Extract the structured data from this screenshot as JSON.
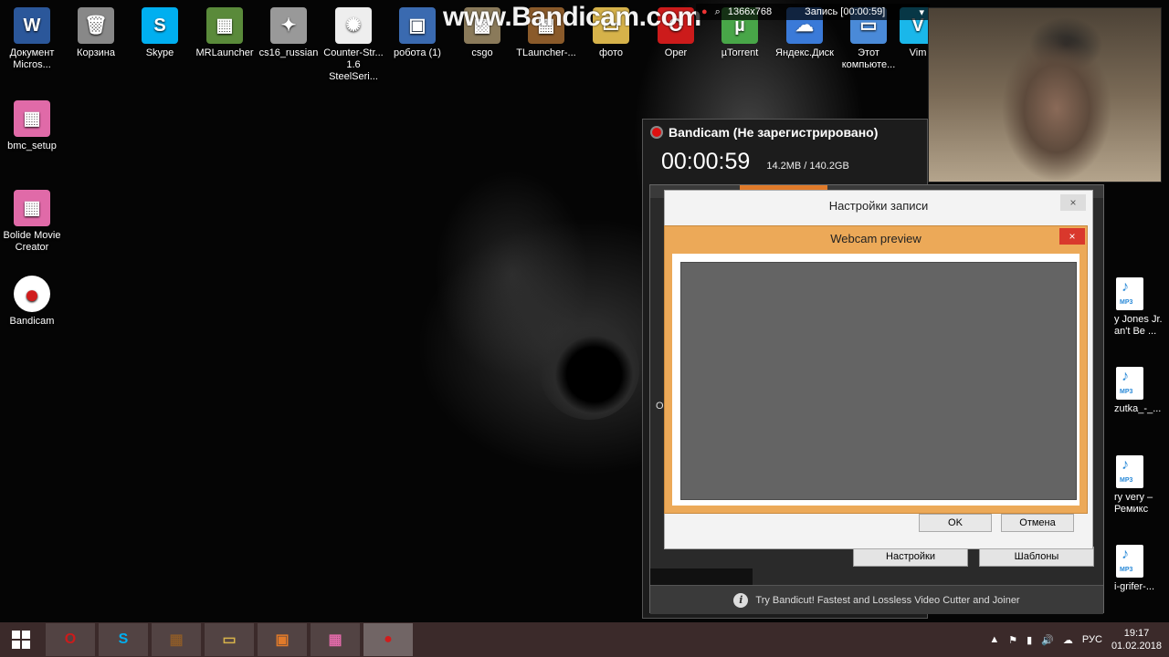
{
  "desktop": {
    "icons_top": [
      {
        "label": "Документ Micros...",
        "glyph": "W",
        "color": "#2b579a"
      },
      {
        "label": "Корзина",
        "glyph": "🗑",
        "color": "#888888"
      },
      {
        "label": "Skype",
        "glyph": "S",
        "color": "#00aff0"
      },
      {
        "label": "MRLauncher",
        "glyph": "▦",
        "color": "#5a8a3a"
      },
      {
        "label": "cs16_russian",
        "glyph": "✦",
        "color": "#999999"
      },
      {
        "label": "Counter-Str... 1.6 SteelSeri...",
        "glyph": "✺",
        "color": "#eeeeee"
      },
      {
        "label": "робота (1)",
        "glyph": "▣",
        "color": "#3a6ab0"
      },
      {
        "label": "csgo",
        "glyph": "▩",
        "color": "#8a7a5a"
      },
      {
        "label": "TLauncher-...",
        "glyph": "▦",
        "color": "#8a5a2a"
      },
      {
        "label": "фото",
        "glyph": "▭",
        "color": "#d6b24a"
      },
      {
        "label": "Oper",
        "glyph": "O",
        "color": "#cc1b1b"
      },
      {
        "label": "µTorrent",
        "glyph": "µ",
        "color": "#48a648"
      },
      {
        "label": "Яндекс.Диск",
        "glyph": "☁",
        "color": "#3a7ad8"
      },
      {
        "label": "Этот компьюте...",
        "glyph": "▭",
        "color": "#4a8ad8"
      },
      {
        "label": "Vim",
        "glyph": "V",
        "color": "#1ab7ea"
      }
    ],
    "icons_left": [
      {
        "label": "bmc_setup",
        "glyph": "▦",
        "color": "#e06aa8"
      },
      {
        "label": "Bolide Movie Creator",
        "glyph": "▦",
        "color": "#e06aa8"
      },
      {
        "label": "Bandicam",
        "glyph": "●",
        "color": "#d01c1c"
      }
    ],
    "mp3_files": [
      {
        "label": "y Jones Jr. an't Be ..."
      },
      {
        "label": "zutka_-_..."
      },
      {
        "label": "ry very – Ремикс"
      },
      {
        "label": "i-grifer-..."
      }
    ],
    "mp3_tag": "MP3"
  },
  "watermark": "www.Bandicam.com",
  "record_strip": {
    "resolution": "1366x768",
    "status": "Запись [00:00:59]"
  },
  "bandicam": {
    "title": "Bandicam (Не зарегистрировано)",
    "timer": "00:00:59",
    "sizes": "14.2MB / 140.2GB",
    "settings_button": "Настройки",
    "templates_button": "Шаблоны",
    "promo": "Try Bandicut! Fastest and Lossless Video Cutter and Joiner",
    "side_letter": "O"
  },
  "settings_dialog": {
    "title": "Настройки записи",
    "ok_label": "OK",
    "cancel_label": "Отмена",
    "close": "×"
  },
  "webcam_dialog": {
    "title": "Webcam preview",
    "close": "×"
  },
  "taskbar": {
    "items": [
      {
        "glyph": "O",
        "color": "#cc1b1b"
      },
      {
        "glyph": "S",
        "color": "#00aff0"
      },
      {
        "glyph": "▦",
        "color": "#8a5a2a"
      },
      {
        "glyph": "▭",
        "color": "#d6b24a"
      },
      {
        "glyph": "▣",
        "color": "#e07a2a"
      },
      {
        "glyph": "▦",
        "color": "#e06aa8"
      },
      {
        "glyph": "●",
        "color": "#d01c1c"
      }
    ],
    "tray_icons": [
      "▲",
      "⚑",
      "▮",
      "🔊",
      "☁"
    ],
    "language": "РУС",
    "time": "19:17",
    "date": "01.02.2018"
  }
}
